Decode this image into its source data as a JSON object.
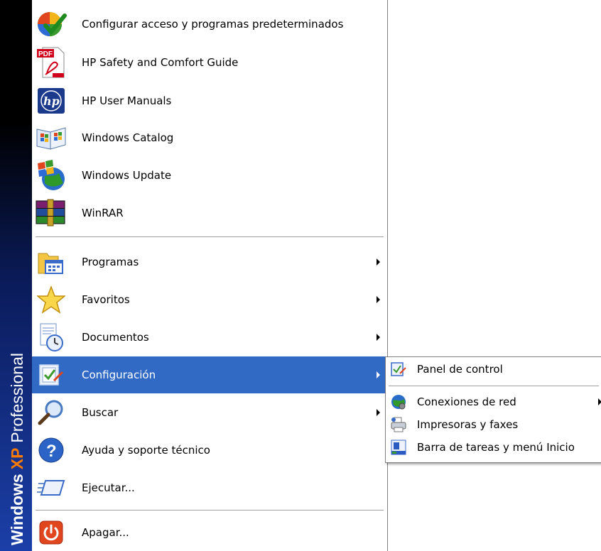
{
  "stripe": {
    "word1": "Windows",
    "word2": "XP",
    "word3": "Professional"
  },
  "pinned": [
    {
      "label": "Configurar acceso y programas predeterminados",
      "icon": "default-programs-icon"
    },
    {
      "label": "HP Safety and Comfort Guide",
      "icon": "pdf-icon"
    },
    {
      "label": "HP User Manuals",
      "icon": "hp-icon"
    },
    {
      "label": "Windows Catalog",
      "icon": "windows-catalog-icon"
    },
    {
      "label": "Windows Update",
      "icon": "windows-update-icon"
    },
    {
      "label": "WinRAR",
      "icon": "winrar-icon"
    }
  ],
  "menu": [
    {
      "label": "Programas",
      "icon": "programs-folder-icon",
      "submenu": true
    },
    {
      "label": "Favoritos",
      "icon": "favorites-star-icon",
      "submenu": true
    },
    {
      "label": "Documentos",
      "icon": "documents-icon",
      "submenu": true
    },
    {
      "label": "Configuración",
      "icon": "settings-icon",
      "submenu": true,
      "selected": true
    },
    {
      "label": "Buscar",
      "icon": "search-magnifier-icon",
      "submenu": true
    },
    {
      "label": "Ayuda y soporte técnico",
      "icon": "help-icon",
      "submenu": false
    },
    {
      "label": "Ejecutar...",
      "icon": "run-icon",
      "submenu": false
    }
  ],
  "shutdown": {
    "label": "Apagar...",
    "icon": "power-icon"
  },
  "submenu": [
    {
      "label": "Panel de control",
      "icon": "control-panel-icon",
      "submenu": false
    },
    {
      "label": "Conexiones de red",
      "icon": "network-connections-icon",
      "submenu": true
    },
    {
      "label": "Impresoras y faxes",
      "icon": "printers-faxes-icon",
      "submenu": false
    },
    {
      "label": "Barra de tareas y menú Inicio",
      "icon": "taskbar-icon",
      "submenu": false
    }
  ],
  "colors": {
    "highlight": "#316ac5",
    "xp_orange": "#ff7a00",
    "stripe_blue": "#1b3fa8"
  }
}
